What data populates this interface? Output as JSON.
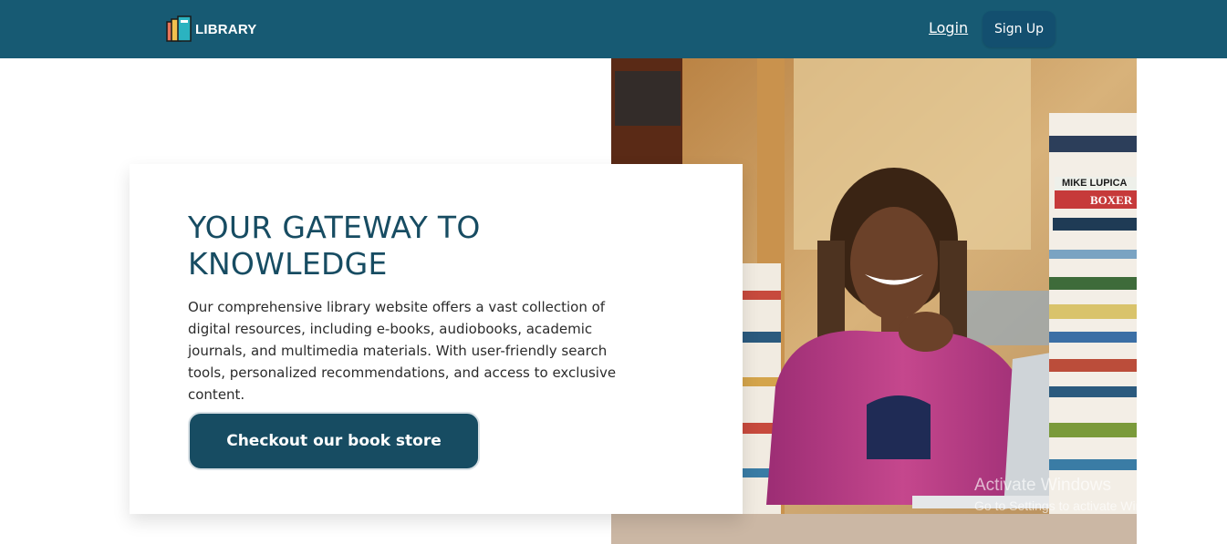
{
  "nav": {
    "brand": "LIBRARY",
    "login": "Login",
    "signup": "Sign Up",
    "logo_icon": "books-icon"
  },
  "hero": {
    "title": "YOUR GATEWAY TO KNOWLEDGE",
    "description": "Our comprehensive library website offers a vast collection of digital resources, including e-books, audiobooks, academic journals, and multimedia materials. With user-friendly search tools, personalized recommendations, and access to exclusive content.",
    "cta": "Checkout our book store"
  },
  "image": {
    "book_spines": [
      "MIKE LUPICA",
      "BOXER"
    ]
  },
  "watermark": {
    "line1": "Activate Windows",
    "line2": "Go to Settings to activate Windows."
  },
  "colors": {
    "navbar": "#175a73",
    "signup_button": "#134f6f",
    "title": "#174c62",
    "cta": "#174c62"
  }
}
